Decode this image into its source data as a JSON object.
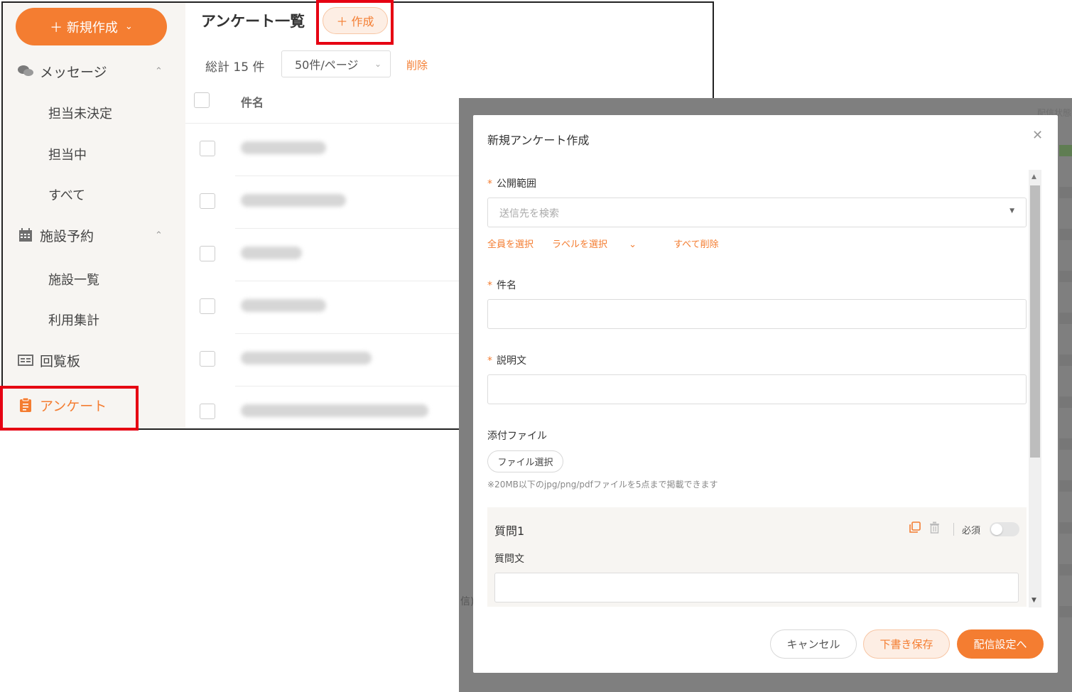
{
  "sidebar": {
    "new_button": "＋ 新規作成",
    "groups": [
      {
        "label": "メッセージ",
        "icon": "chat-bubbles-icon",
        "items": [
          "担当未決定",
          "担当中",
          "すべて"
        ]
      },
      {
        "label": "施設予約",
        "icon": "calendar-icon",
        "items": [
          "施設一覧",
          "利用集計"
        ]
      },
      {
        "label": "回覧板",
        "icon": "board-icon",
        "items": []
      },
      {
        "label": "アンケート",
        "icon": "clipboard-icon",
        "items": []
      }
    ]
  },
  "main": {
    "title": "アンケート一覧",
    "create_button": "＋ 作成",
    "total": "総計 15 件",
    "per_page": "50件/ページ",
    "delete_link": "削除",
    "column_name": "件名"
  },
  "overlay_bg": {
    "col_header": "配信状態",
    "side_text": "信)"
  },
  "modal": {
    "title": "新規アンケート作成",
    "scope_label": "公開範囲",
    "scope_placeholder": "送信先を検索",
    "select_all": "全員を選択",
    "select_label": "ラベルを選択",
    "delete_all": "すべて削除",
    "subject_label": "件名",
    "description_label": "説明文",
    "attachment_label": "添付ファイル",
    "file_button": "ファイル選択",
    "file_note": "※20MB以下のjpg/png/pdfファイルを5点まで掲載できます",
    "question": {
      "title": "質問1",
      "required_label": "必須",
      "text_label": "質問文"
    },
    "buttons": {
      "cancel": "キャンセル",
      "draft": "下書き保存",
      "next": "配信設定へ"
    }
  },
  "colors": {
    "accent": "#f47d31",
    "highlight": "#e60012",
    "overlay": "#7f7f7f"
  }
}
